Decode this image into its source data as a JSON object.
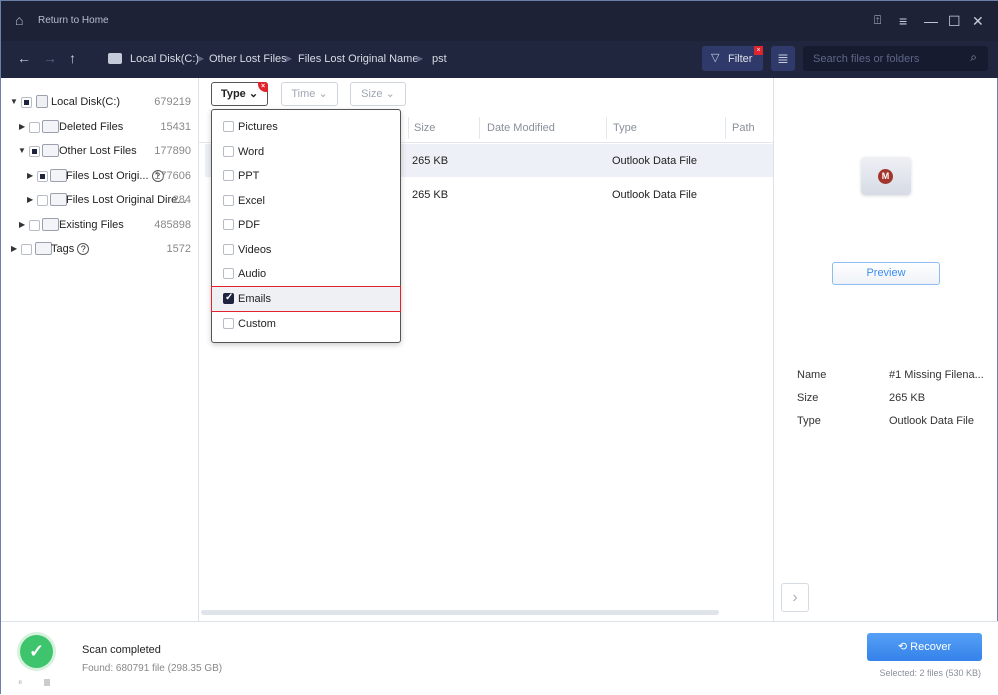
{
  "titlebar": {
    "return_label": "Return to Home",
    "icons": [
      "home-icon",
      "feedback-icon",
      "menu-icon",
      "minimize-icon",
      "maximize-icon",
      "close-icon"
    ]
  },
  "navbar": {
    "breadcrumb": [
      "Local Disk(C:)",
      "Other Lost Files",
      "Files Lost Original Name",
      "pst"
    ],
    "filter_label": "Filter",
    "search_placeholder": "Search files or folders"
  },
  "tree": [
    {
      "label": "Local Disk(C:)",
      "count": "679219",
      "state": "partial",
      "expanded": true
    },
    {
      "label": "Deleted Files",
      "count": "15431",
      "state": "none"
    },
    {
      "label": "Other Lost Files",
      "count": "177890",
      "state": "partial",
      "expanded": true
    },
    {
      "label": "Files Lost Origi...",
      "count": "177606",
      "state": "partial",
      "help": true
    },
    {
      "label": "Files Lost Original Dire...",
      "count": "284",
      "state": "none"
    },
    {
      "label": "Existing Files",
      "count": "485898",
      "state": "none"
    },
    {
      "label": "Tags",
      "count": "1572",
      "state": "none",
      "help": true
    }
  ],
  "filters": {
    "type": "Type",
    "time": "Time",
    "size": "Size"
  },
  "type_options": [
    {
      "label": "Pictures",
      "checked": false
    },
    {
      "label": "Word",
      "checked": false
    },
    {
      "label": "PPT",
      "checked": false
    },
    {
      "label": "Excel",
      "checked": false
    },
    {
      "label": "PDF",
      "checked": false
    },
    {
      "label": "Videos",
      "checked": false
    },
    {
      "label": "Audio",
      "checked": false
    },
    {
      "label": "Emails",
      "checked": true
    },
    {
      "label": "Custom",
      "checked": false
    }
  ],
  "table": {
    "columns": [
      "Size",
      "Date Modified",
      "Type",
      "Path"
    ],
    "rows": [
      {
        "size": "265 KB",
        "date": "",
        "type": "Outlook Data File"
      },
      {
        "size": "265 KB",
        "date": "",
        "type": "Outlook Data File"
      }
    ]
  },
  "preview": {
    "button": "Preview",
    "details": [
      {
        "key": "Name",
        "value": "#1 Missing Filena..."
      },
      {
        "key": "Size",
        "value": "265 KB"
      },
      {
        "key": "Type",
        "value": "Outlook Data File"
      }
    ]
  },
  "status": {
    "title": "Scan completed",
    "found": "Found: 680791 file (298.35 GB)",
    "recover": "Recover",
    "selected": "Selected: 2 files (530 KB)"
  },
  "colors": {
    "accent": "#3d8ef0",
    "titlebar": "#1d2237",
    "highlight": "#e0232c",
    "success": "#3ec46d"
  }
}
